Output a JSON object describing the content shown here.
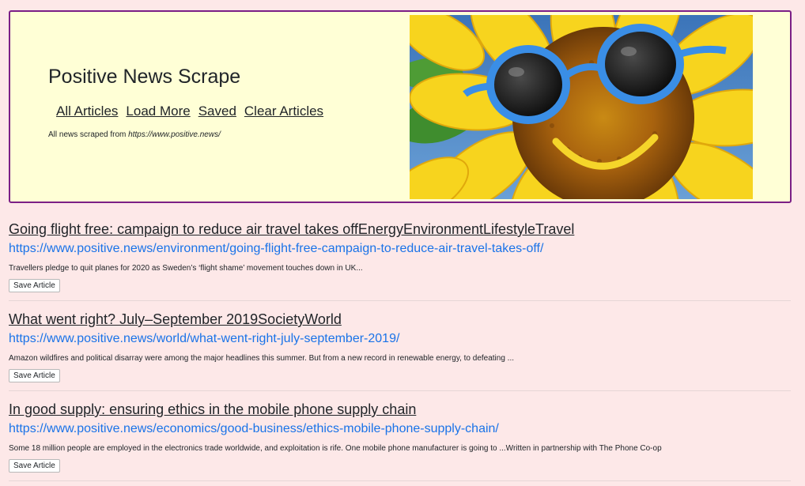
{
  "header": {
    "title": "Positive News Scrape",
    "nav": [
      "All Articles",
      "Load More",
      "Saved",
      "Clear Articles"
    ],
    "source_prefix": "All news scraped from ",
    "source_url": "https://www.positive.news/"
  },
  "articles": [
    {
      "title": "Going flight free: campaign to reduce air travel takes offEnergyEnvironmentLifestyleTravel",
      "url": "https://www.positive.news/environment/going-flight-free-campaign-to-reduce-air-travel-takes-off/",
      "summary": "Travellers pledge to quit planes for 2020 as Sweden’s ‘flight shame’ movement touches down in UK...",
      "save_label": "Save Article"
    },
    {
      "title": "What went right? July–September 2019SocietyWorld",
      "url": "https://www.positive.news/world/what-went-right-july-september-2019/",
      "summary": "Amazon wildfires and political disarray were among the major headlines this summer. But from a new record in renewable energy, to defeating ...",
      "save_label": "Save Article"
    },
    {
      "title": "In good supply: ensuring ethics in the mobile phone supply chain",
      "url": "https://www.positive.news/economics/good-business/ethics-mobile-phone-supply-chain/",
      "summary": "Some 18 million people are employed in the electronics trade worldwide, and exploitation is rife. One mobile phone manufacturer is going to ...Written in partnership with The Phone Co-op",
      "save_label": "Save Article"
    }
  ]
}
